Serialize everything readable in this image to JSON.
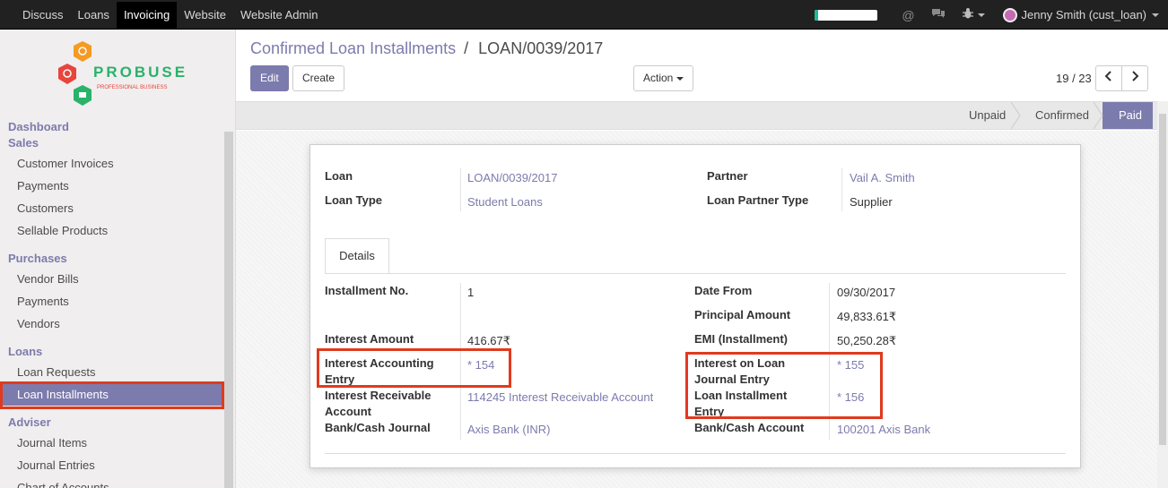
{
  "topbar": {
    "menu": [
      "Discuss",
      "Loans",
      "Invoicing",
      "Website",
      "Website Admin"
    ],
    "active_menu": "Invoicing",
    "progress": 0.05,
    "icons": [
      "at-icon",
      "chat-icon",
      "bug-icon"
    ],
    "user": "Jenny Smith (cust_loan)"
  },
  "sidebar": {
    "logo_text": "PROBUSE",
    "logo_tagline": "PROFESSIONAL BUSINESS",
    "dashboard": "Dashboard",
    "sales": {
      "title": "Sales",
      "items": [
        "Customer Invoices",
        "Payments",
        "Customers",
        "Sellable Products"
      ]
    },
    "purchases": {
      "title": "Purchases",
      "items": [
        "Vendor Bills",
        "Payments",
        "Vendors"
      ]
    },
    "loans": {
      "title": "Loans",
      "items": [
        "Loan Requests",
        "Loan Installments"
      ]
    },
    "adviser": {
      "title": "Adviser",
      "items": [
        "Journal Items",
        "Journal Entries",
        "Chart of Accounts"
      ]
    }
  },
  "breadcrumb": {
    "parent": "Confirmed Loan Installments",
    "separator": "/",
    "current": "LOAN/0039/2017"
  },
  "buttons": {
    "edit": "Edit",
    "create": "Create",
    "action": "Action"
  },
  "pager": {
    "value": "19 / 23"
  },
  "statusbar": {
    "stages": [
      "Unpaid",
      "Confirmed",
      "Paid"
    ],
    "active": "Paid"
  },
  "form": {
    "loan_label": "Loan",
    "loan_value": "LOAN/0039/2017",
    "loan_type_label": "Loan Type",
    "loan_type_value": "Student Loans",
    "partner_label": "Partner",
    "partner_value": "Vail A. Smith",
    "partner_type_label": "Loan Partner Type",
    "partner_type_value": "Supplier",
    "tab_label": "Details",
    "left": [
      {
        "label": "Installment No.",
        "value": "1"
      },
      {
        "label": "Interest Amount",
        "value": "416.67₹"
      },
      {
        "label": "Interest Accounting Entry",
        "value": "* 154"
      },
      {
        "label": "Interest Receivable Account",
        "value": "114245 Interest Receivable Account"
      },
      {
        "label": "Bank/Cash Journal",
        "value": "Axis Bank (INR)"
      }
    ],
    "right": [
      {
        "label": "Date From",
        "value": "09/30/2017"
      },
      {
        "label": "Principal Amount",
        "value": "49,833.61₹"
      },
      {
        "label": "EMI (Installment)",
        "value": "50,250.28₹"
      },
      {
        "label": "Interest on Loan Journal Entry",
        "value": "* 155"
      },
      {
        "label": "Loan Installment Entry",
        "value": "* 156"
      },
      {
        "label": "Bank/Cash Account",
        "value": "100201 Axis Bank"
      }
    ]
  },
  "colors": {
    "accent": "#7c7bad",
    "highlight": "#e03a1e",
    "topbar": "#212121"
  }
}
